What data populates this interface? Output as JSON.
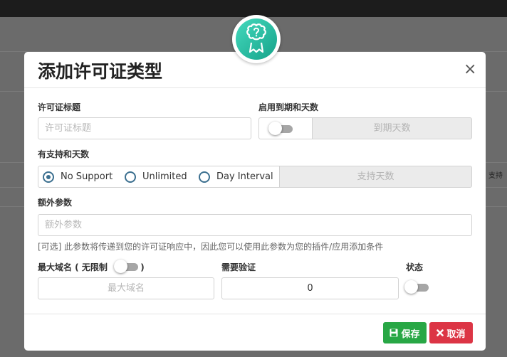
{
  "background": {
    "right_text": "支持"
  },
  "modal": {
    "title": "添加许可证类型",
    "close_label": "×",
    "badge_icon": "award-ribbon-question-icon",
    "license_title": {
      "label": "许可证标题",
      "placeholder": "许可证标题",
      "value": ""
    },
    "expiry": {
      "label": "启用到期和天数",
      "toggle_on": false,
      "days_placeholder": "到期天数"
    },
    "support": {
      "label": "有支持和天数",
      "options": [
        "No Support",
        "Unlimited",
        "Day Interval"
      ],
      "selected": "No Support",
      "days_placeholder": "支持天数"
    },
    "extra_params": {
      "label": "额外参数",
      "placeholder": "额外参数",
      "help": "[可选] 此参数将传递到您的许可证响应中，因此您可以使用此参数为您的插件/应用添加条件"
    },
    "max_domains": {
      "label_prefix": "最大域名 ( 无限制",
      "label_suffix": ")",
      "toggle_on": false,
      "placeholder": "最大域名"
    },
    "require_verify": {
      "label": "需要验证",
      "value": "0"
    },
    "status": {
      "label": "状态",
      "toggle_on": false
    },
    "footer": {
      "save_label": "保存",
      "cancel_label": "取消",
      "save_color": "#28a745",
      "cancel_color": "#dc3545",
      "save_icon": "floppy-disk-icon",
      "cancel_icon": "x-icon"
    }
  }
}
